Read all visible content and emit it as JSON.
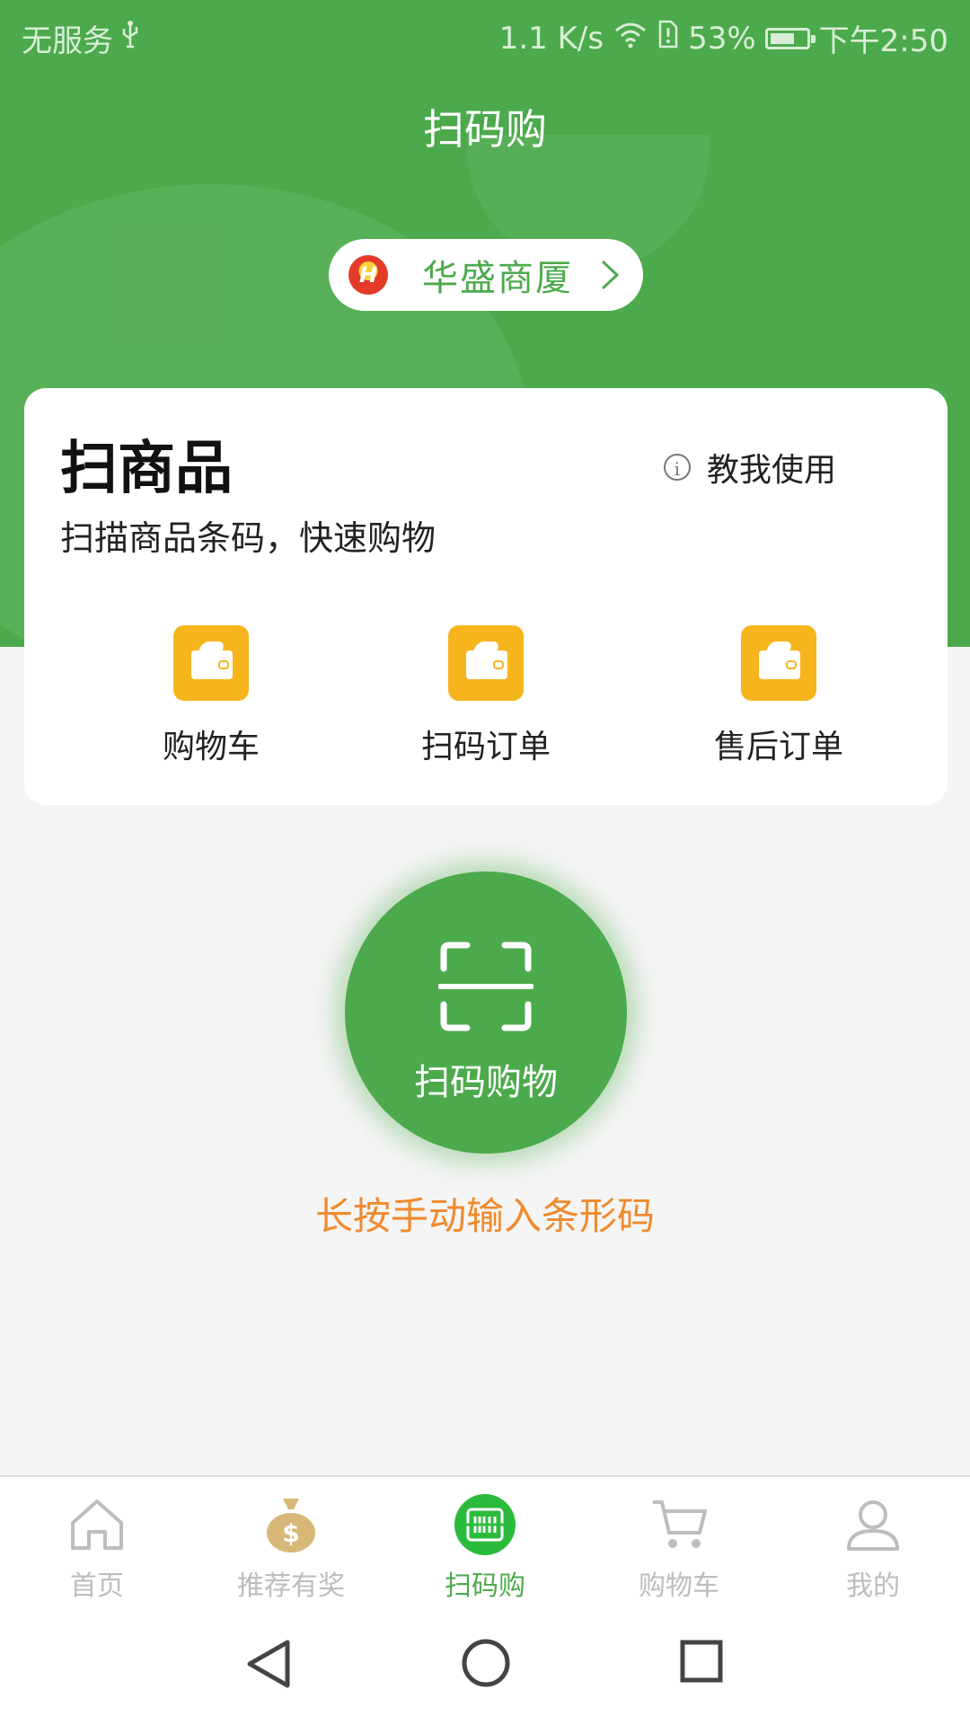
{
  "status_bar": {
    "carrier": "无服务",
    "speed": "1.1 K/s",
    "battery": "53%",
    "time": "下午2:50"
  },
  "header": {
    "title": "扫码购"
  },
  "store": {
    "name": "华盛商厦",
    "logo_letter": "H"
  },
  "card": {
    "title": "扫商品",
    "subtitle": "扫描商品条码，快速购物",
    "help_label": "教我使用",
    "shortcuts": [
      {
        "label": "购物车",
        "icon": "wallet-icon"
      },
      {
        "label": "扫码订单",
        "icon": "wallet-icon"
      },
      {
        "label": "售后订单",
        "icon": "wallet-icon"
      }
    ]
  },
  "scan": {
    "label": "扫码购物",
    "hint": "长按手动输入条形码"
  },
  "tabs": [
    {
      "label": "首页",
      "icon": "home-icon"
    },
    {
      "label": "推荐有奖",
      "icon": "money-bag-icon"
    },
    {
      "label": "扫码购",
      "icon": "barcode-scan-icon",
      "active": true
    },
    {
      "label": "购物车",
      "icon": "cart-icon"
    },
    {
      "label": "我的",
      "icon": "profile-icon"
    }
  ],
  "colors": {
    "brand_green": "#4caa4c",
    "accent_orange": "#ef8a2e",
    "wallet_yellow": "#f7b51d",
    "inactive_gray": "#bdbdbd"
  }
}
